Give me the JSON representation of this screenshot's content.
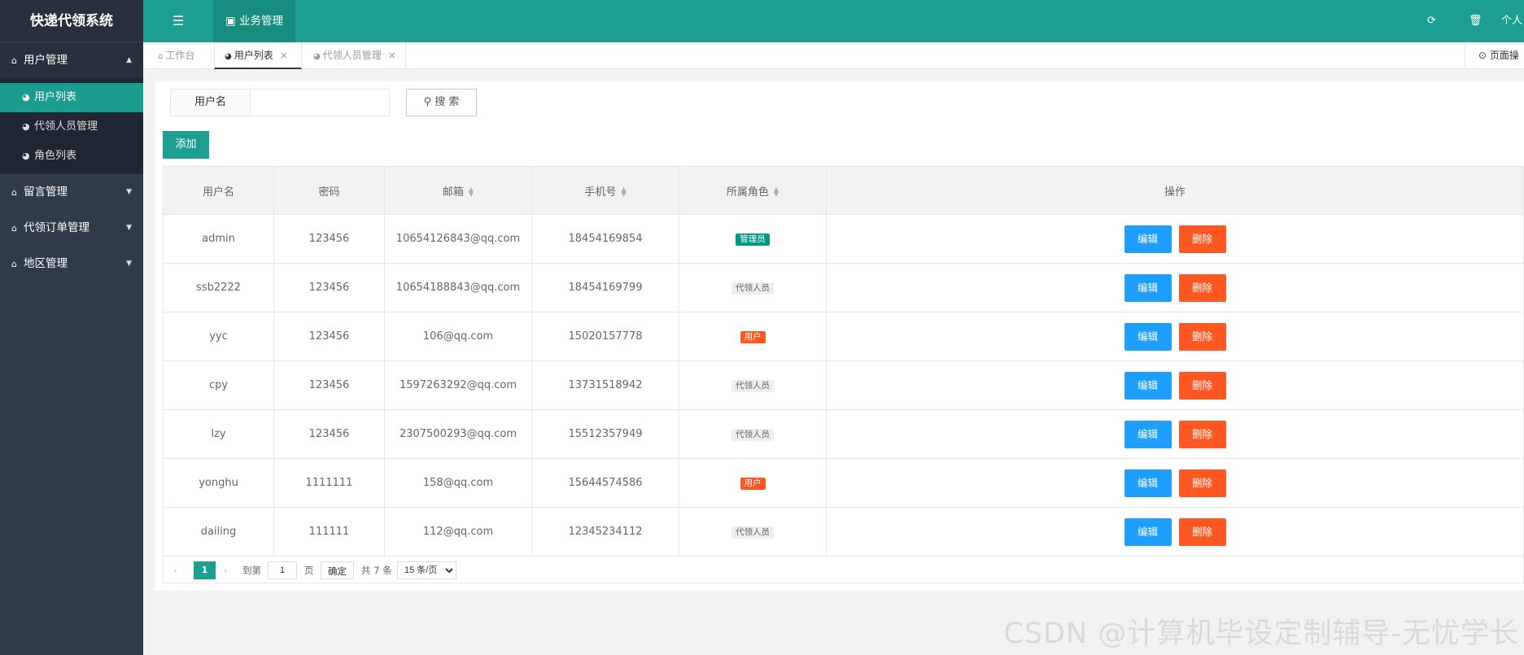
{
  "app": {
    "title": "快递代领系统"
  },
  "sidebar": {
    "groups": [
      {
        "label": "用户管理",
        "open": true,
        "items": [
          {
            "label": "用户列表",
            "active": true
          },
          {
            "label": "代领人员管理"
          },
          {
            "label": "角色列表"
          }
        ]
      },
      {
        "label": "留言管理"
      },
      {
        "label": "代领订单管理"
      },
      {
        "label": "地区管理"
      }
    ]
  },
  "header": {
    "menu_icon": "list-icon",
    "biz_tab": "业务管理",
    "icons": [
      "refresh-icon",
      "trash-icon"
    ],
    "user_label": "个人"
  },
  "tabs": [
    {
      "label": "工作台",
      "icon": "home-icon"
    },
    {
      "label": "用户列表",
      "icon": "dashboard-icon",
      "active": true,
      "close": "×"
    },
    {
      "label": "代领人员管理",
      "icon": "dashboard-icon",
      "close": "×"
    }
  ],
  "page_op": {
    "label": "页面操"
  },
  "search": {
    "label": "用户名",
    "value": "",
    "placeholder": "",
    "button": "搜 索"
  },
  "toolbar": {
    "add": "添加"
  },
  "table": {
    "headers": [
      "用户名",
      "密码",
      "邮箱",
      "手机号",
      "所属角色",
      "操作"
    ],
    "rows": [
      {
        "username": "admin",
        "password": "123456",
        "email": "10654126843@qq.com",
        "phone": "18454169854",
        "role": "管理员",
        "role_color": "#009688",
        "role_text_color": "#ffffff"
      },
      {
        "username": "ssb2222",
        "password": "123456",
        "email": "10654188843@qq.com",
        "phone": "18454169799",
        "role": "代领人员",
        "role_color": "#eeeeee",
        "role_text_color": "#666666"
      },
      {
        "username": "yyc",
        "password": "123456",
        "email": "106@qq.com",
        "phone": "15020157778",
        "role": "用户",
        "role_color": "#ff5722",
        "role_text_color": "#ffffff"
      },
      {
        "username": "cpy",
        "password": "123456",
        "email": "1597263292@qq.com",
        "phone": "13731518942",
        "role": "代领人员",
        "role_color": "#eeeeee",
        "role_text_color": "#666666"
      },
      {
        "username": "lzy",
        "password": "123456",
        "email": "2307500293@qq.com",
        "phone": "15512357949",
        "role": "代领人员",
        "role_color": "#eeeeee",
        "role_text_color": "#666666"
      },
      {
        "username": "yonghu",
        "password": "1111111",
        "email": "158@qq.com",
        "phone": "15644574586",
        "role": "用户",
        "role_color": "#ff5722",
        "role_text_color": "#ffffff"
      },
      {
        "username": "dailing",
        "password": "111111",
        "email": "112@qq.com",
        "phone": "12345234112",
        "role": "代领人员",
        "role_color": "#eeeeee",
        "role_text_color": "#666666"
      }
    ],
    "edit_label": "编辑",
    "delete_label": "删除"
  },
  "pagination": {
    "prev": "‹",
    "next": "›",
    "current": "1",
    "goto_label": "到第",
    "goto_value": "1",
    "page_unit": "页",
    "confirm": "确定",
    "total": "共 7 条",
    "page_size": "15 条/页"
  },
  "watermark": "CSDN @计算机毕设定制辅导-无忧学长",
  "colors": {
    "primary": "#1c9f91",
    "sidebar": "#2f3a4a",
    "edit": "#1e9fff",
    "danger": "#ff5722"
  }
}
